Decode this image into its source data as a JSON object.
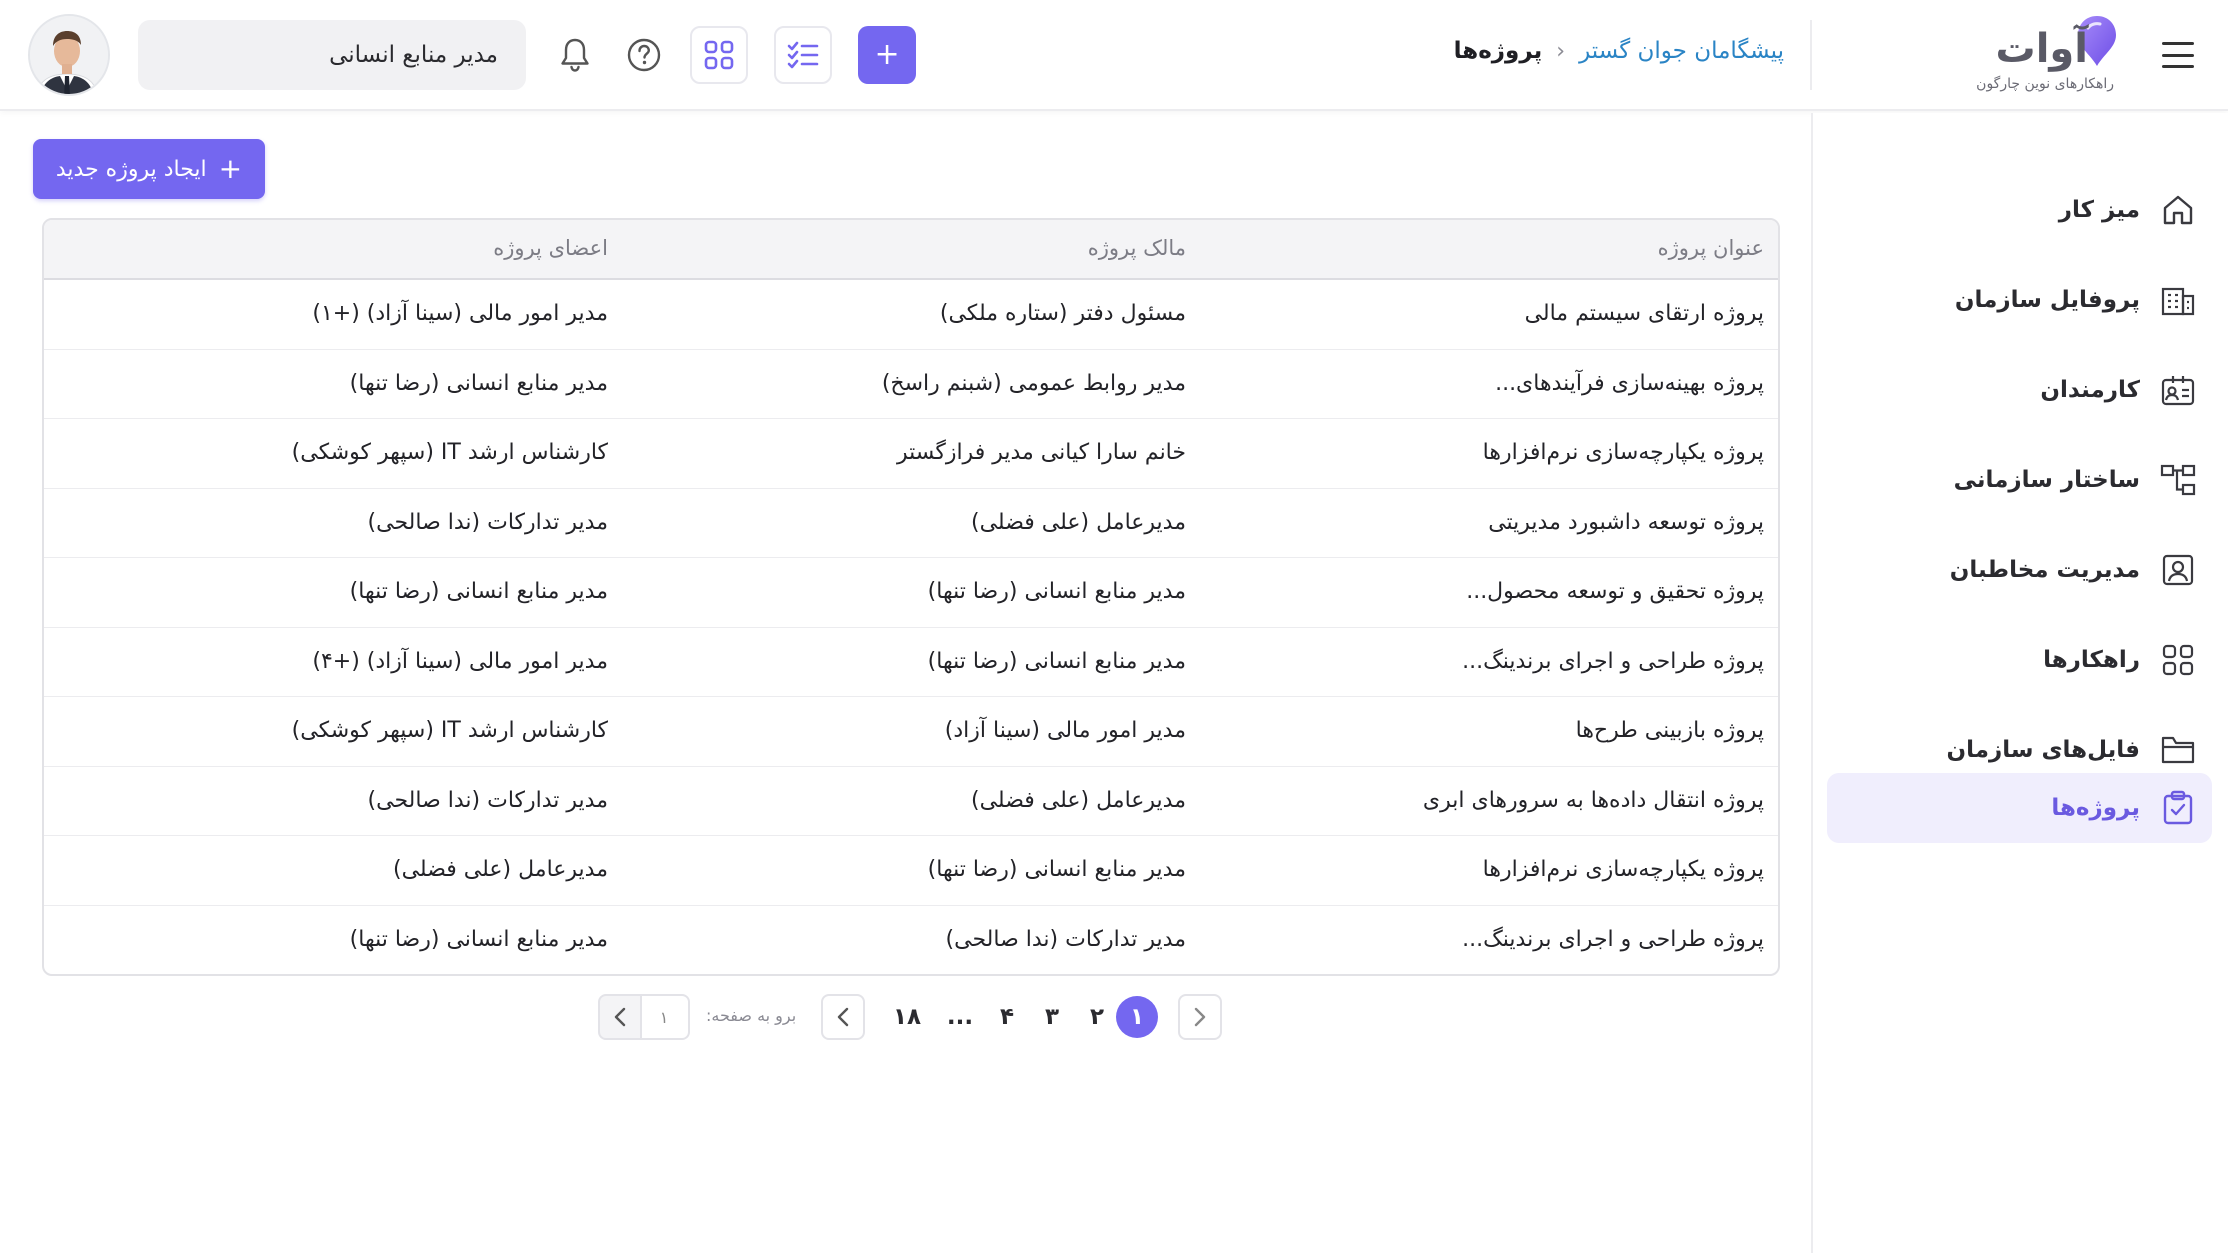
{
  "header": {
    "logo_text": "آوات",
    "logo_subtitle": "راهکارهای نوین چارگون",
    "breadcrumb": {
      "parent": "پیشگامان جوان گستر",
      "current": "پروژه‌ها"
    },
    "role_select": "مدیر منابع انسانی",
    "icons": [
      "menu-icon",
      "bell-icon",
      "help-icon",
      "apps-icon",
      "tasks-icon",
      "plus-icon"
    ]
  },
  "sidebar": {
    "items": [
      {
        "label": "میز کار",
        "icon": "home-icon"
      },
      {
        "label": "پروفایل سازمان",
        "icon": "building-icon"
      },
      {
        "label": "کارمندان",
        "icon": "id-card-icon"
      },
      {
        "label": "ساختار سازمانی",
        "icon": "org-chart-icon"
      },
      {
        "label": "مدیریت مخاطبان",
        "icon": "contact-icon"
      },
      {
        "label": "راهکارها",
        "icon": "grid-icon"
      },
      {
        "label": "فایل‌های سازمان",
        "icon": "folder-icon"
      },
      {
        "label": "پروژه‌ها",
        "icon": "clipboard-check-icon",
        "active": true
      }
    ]
  },
  "main": {
    "create_button": "ایجاد پروژه جدید",
    "table": {
      "headers": {
        "title": "عنوان پروژه",
        "owner": "مالک پروژه",
        "members": "اعضای پروژه"
      },
      "rows": [
        {
          "title": "پروژه  ارتقای سیستم مالی",
          "owner": "مسئول دفتر (ستاره ملکی)",
          "members": "مدیر امور مالی (سینا آزاد) (+۱)"
        },
        {
          "title": "پروژه بهینه‌سازی فرآیندهای...",
          "owner": "مدیر روابط عمومی (شبنم راسخ)",
          "members": "مدیر منابع انسانی (رضا تنها)"
        },
        {
          "title": "پروژه یکپارچه‌سازی نرم‌افزارها",
          "owner": "خانم سارا کیانی مدیر فرازگستر",
          "members": "کارشناس ارشد IT (سپهر کوشکی)"
        },
        {
          "title": "پروژه  توسعه داشبورد مدیریتی",
          "owner": "مدیرعامل (علی فضلی)",
          "members": "مدیر تدارکات (ندا صالحی)"
        },
        {
          "title": "پروژه تحقیق و توسعه محصول...",
          "owner": "مدیر منابع انسانی (رضا تنها)",
          "members": "مدیر منابع انسانی (رضا تنها)"
        },
        {
          "title": "پروژه طراحی و اجرای برندینگ...",
          "owner": "مدیر منابع انسانی (رضا تنها)",
          "members": "مدیر امور مالی (سینا آزاد) (+۴)"
        },
        {
          "title": "پروژه بازبینی طرح‌ها",
          "owner": "مدیر امور مالی (سینا آزاد)",
          "members": "کارشناس ارشد IT (سپهر کوشکی)"
        },
        {
          "title": "پروژه انتقال داده‌ها به سرورهای ابری",
          "owner": "مدیرعامل (علی فضلی)",
          "members": "مدیر تدارکات (ندا صالحی)"
        },
        {
          "title": "پروژه یکپارچه‌سازی نرم‌افزارها",
          "owner": "مدیر منابع انسانی (رضا تنها)",
          "members": "مدیرعامل (علی فضلی)"
        },
        {
          "title": "پروژه طراحی و اجرای برندینگ...",
          "owner": "مدیر تدارکات (ندا صالحی)",
          "members": "مدیر منابع انسانی (رضا تنها)"
        }
      ]
    },
    "pagination": {
      "pages": [
        "۱",
        "۲",
        "۳",
        "۴",
        "...",
        "۱۸"
      ],
      "current": "۱",
      "goto_label": "برو به صفحه:",
      "goto_value": "۱"
    }
  },
  "colors": {
    "accent": "#7467f0",
    "link": "#2a84c5",
    "active_bg": "#f0eefd"
  }
}
